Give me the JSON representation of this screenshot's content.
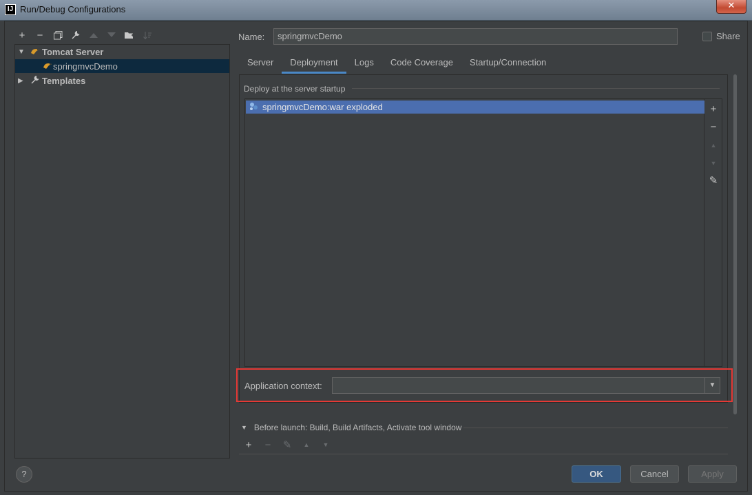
{
  "window": {
    "title": "Run/Debug Configurations",
    "close_glyph": "✕"
  },
  "left_toolbar": {
    "add": "+",
    "remove": "−",
    "copy": "⧉",
    "edit": "🔧",
    "up": "▲",
    "down": "▼",
    "folder": "📁",
    "sort": "↓"
  },
  "tree": {
    "tomcat": {
      "label": "Tomcat Server",
      "icon": "tomcat-icon"
    },
    "config": {
      "label": "springmvcDemo",
      "icon": "tomcat-config-icon"
    },
    "templates": {
      "label": "Templates",
      "icon": "wrench-icon"
    }
  },
  "name": {
    "label": "Name:",
    "value": "springmvcDemo"
  },
  "share": {
    "label": "Share",
    "checked": false
  },
  "tabs": [
    {
      "label": "Server",
      "active": false
    },
    {
      "label": "Deployment",
      "active": true
    },
    {
      "label": "Logs",
      "active": false
    },
    {
      "label": "Code Coverage",
      "active": false
    },
    {
      "label": "Startup/Connection",
      "active": false
    }
  ],
  "deployment": {
    "title": "Deploy at the server startup",
    "items": [
      {
        "label": "springmvcDemo:war exploded",
        "icon": "artifact-icon"
      }
    ],
    "tools": {
      "add": "+",
      "remove": "−",
      "up": "▲",
      "down": "▼",
      "edit": "✎"
    }
  },
  "app_context": {
    "label": "Application context:",
    "value": ""
  },
  "before_launch": {
    "label": "Before launch: Build, Build Artifacts, Activate tool window",
    "tools": {
      "add": "+",
      "remove": "−",
      "edit": "✎",
      "up": "▲",
      "down": "▼"
    }
  },
  "footer": {
    "help": "?",
    "ok": "OK",
    "cancel": "Cancel",
    "apply": "Apply"
  },
  "colors": {
    "background": "#3c3f41",
    "selection": "#4b6eaf",
    "tab_underline": "#4a88c7",
    "highlight_border": "#e53935",
    "ok_button": "#365880"
  }
}
